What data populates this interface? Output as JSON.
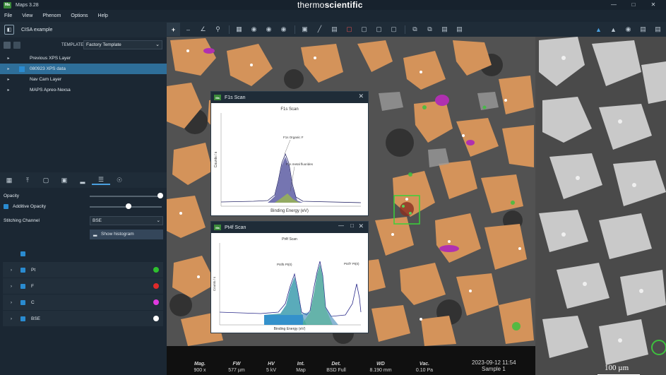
{
  "app": {
    "title": "Maps 3.28",
    "badge": "Ma",
    "brand_a": "thermo",
    "brand_b": "scientific"
  },
  "window_controls": [
    "—",
    "□",
    "✕"
  ],
  "menu": [
    "File",
    "View",
    "Phenom",
    "Options",
    "Help"
  ],
  "project": {
    "name": "CISA example"
  },
  "template": {
    "label": "TEMPLATE",
    "value": "Factory Template"
  },
  "layers": [
    {
      "label": "Previous XPS Layer",
      "checked": false
    },
    {
      "label": "080923 XPS data",
      "checked": true,
      "selected": true
    },
    {
      "label": "Nav Cam Layer",
      "checked": false
    },
    {
      "label": "MAPS Apreo-Nexsa",
      "checked": false
    }
  ],
  "controls": {
    "opacity_label": "Opacity",
    "opacity_value": 1.0,
    "additive_label": "Additive Opacity",
    "additive_value": 0.55,
    "stitching_label": "Stitching Channel",
    "stitching_value": "BSE",
    "histogram_button": "Show histogram"
  },
  "channels": [
    {
      "label": "",
      "color": ""
    },
    {
      "label": "Pt",
      "color": "#2ec02e"
    },
    {
      "label": "F",
      "color": "#e02a2a"
    },
    {
      "label": "C",
      "color": "#e03ae0"
    },
    {
      "label": "BSE",
      "color": "#ffffff"
    }
  ],
  "status": {
    "items": [
      {
        "key": "Mag.",
        "value": "900 x"
      },
      {
        "key": "FW",
        "value": "577 µm"
      },
      {
        "key": "HV",
        "value": "5 kV"
      },
      {
        "key": "Int.",
        "value": "Map"
      },
      {
        "key": "Det.",
        "value": "BSD Full"
      },
      {
        "key": "WD",
        "value": "8.190 mm"
      },
      {
        "key": "Vac.",
        "value": "0.10 Pa"
      }
    ],
    "datetime": "2023-09-12 11:54",
    "sample": "Sample 1"
  },
  "scalebar": "100 µm",
  "f1s": {
    "window_title": "F1s Scan",
    "plot_title": "F1s Scan",
    "ylabel": "Counts / s",
    "xlabel": "Binding Energy (eV)",
    "annot1": "F1s Organic F",
    "annot2": "F1s metal fluorides"
  },
  "pt4f": {
    "window_title": "Pt4f Scan",
    "plot_title": "Pt4f Scan",
    "ylabel": "Counts / s",
    "xlabel": "Binding Energy (eV)",
    "annot1": "Pt4f5 Pt(0)",
    "annot2": "Pt4f7 Pt(0)"
  },
  "colors": {
    "accent": "#2a8bd0",
    "selected_row": "#2e6e99",
    "particle": "#d4935a"
  }
}
